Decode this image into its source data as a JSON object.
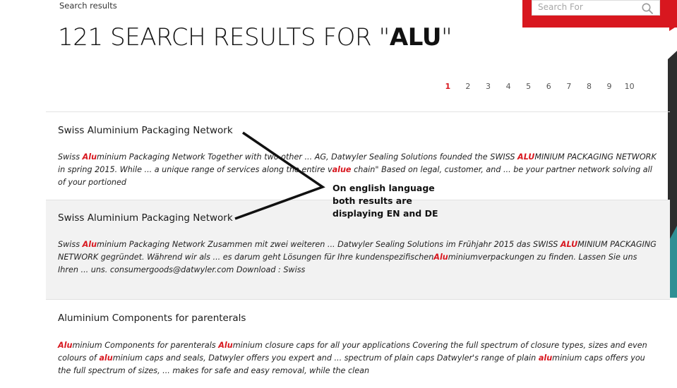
{
  "breadcrumb": "Search results",
  "search": {
    "placeholder": "Search For"
  },
  "title": {
    "prefix": "121 SEARCH RESULTS FOR \"",
    "term": "ALU",
    "suffix": "\""
  },
  "pagination": {
    "pages": [
      "1",
      "2",
      "3",
      "4",
      "5",
      "6",
      "7",
      "8",
      "9",
      "10"
    ],
    "active": "1"
  },
  "results": [
    {
      "title": "Swiss Aluminium Packaging Network",
      "parts": [
        {
          "t": "Swiss "
        },
        {
          "t": "Alu",
          "h": 1
        },
        {
          "t": "minium Packaging Network Together with two other ... AG, Datwyler Sealing Solutions founded the SWISS "
        },
        {
          "t": "ALU",
          "h": 1
        },
        {
          "t": "MINIUM PACKAGING NETWORK in spring 2015. While ... a unique range of services along the entire v"
        },
        {
          "t": "alue",
          "h": 1
        },
        {
          "t": " chain\"   Based on legal, customer, and ... be your partner network solving all of your portioned"
        }
      ]
    },
    {
      "title": "Swiss Aluminium Packaging Network",
      "parts": [
        {
          "t": "Swiss "
        },
        {
          "t": "Alu",
          "h": 1
        },
        {
          "t": "minium Packaging Network Zusammen mit zwei weiteren ... Datwyler Sealing Solutions im Frühjahr 2015 das SWISS "
        },
        {
          "t": "ALU",
          "h": 1
        },
        {
          "t": "MINIUM PACKAGING NETWORK gegründet. Während wir als ... es darum geht Lösungen für Ihre kundenspezifischen"
        },
        {
          "t": "Alu",
          "h": 1
        },
        {
          "t": "miniumverpackungen zu finden. Lassen Sie uns Ihren ... uns. consumergoods@datwyler.com Download : Swiss"
        }
      ]
    },
    {
      "title": "Aluminium Components for parenterals",
      "parts": [
        {
          "t": "Alu",
          "h": 1
        },
        {
          "t": "minium Components for parenterals "
        },
        {
          "t": "Alu",
          "h": 1
        },
        {
          "t": "minium closure caps for all your applications Covering the full spectrum of closure types, sizes and even colours of "
        },
        {
          "t": "alu",
          "h": 1
        },
        {
          "t": "minium caps and seals, Datwyler offers you expert and ... spectrum of plain caps Datwyler's range of plain "
        },
        {
          "t": "alu",
          "h": 1
        },
        {
          "t": "minium caps offers you the full spectrum of sizes, ... makes for safe and easy removal, while the clean"
        }
      ]
    }
  ],
  "annotation": {
    "lines": [
      "On english language",
      "both results are",
      "displaying EN and DE"
    ]
  },
  "colors": {
    "accent": "#d8171f",
    "dark_side": "#2d2d2d",
    "teal_side": "#2f8f94"
  }
}
